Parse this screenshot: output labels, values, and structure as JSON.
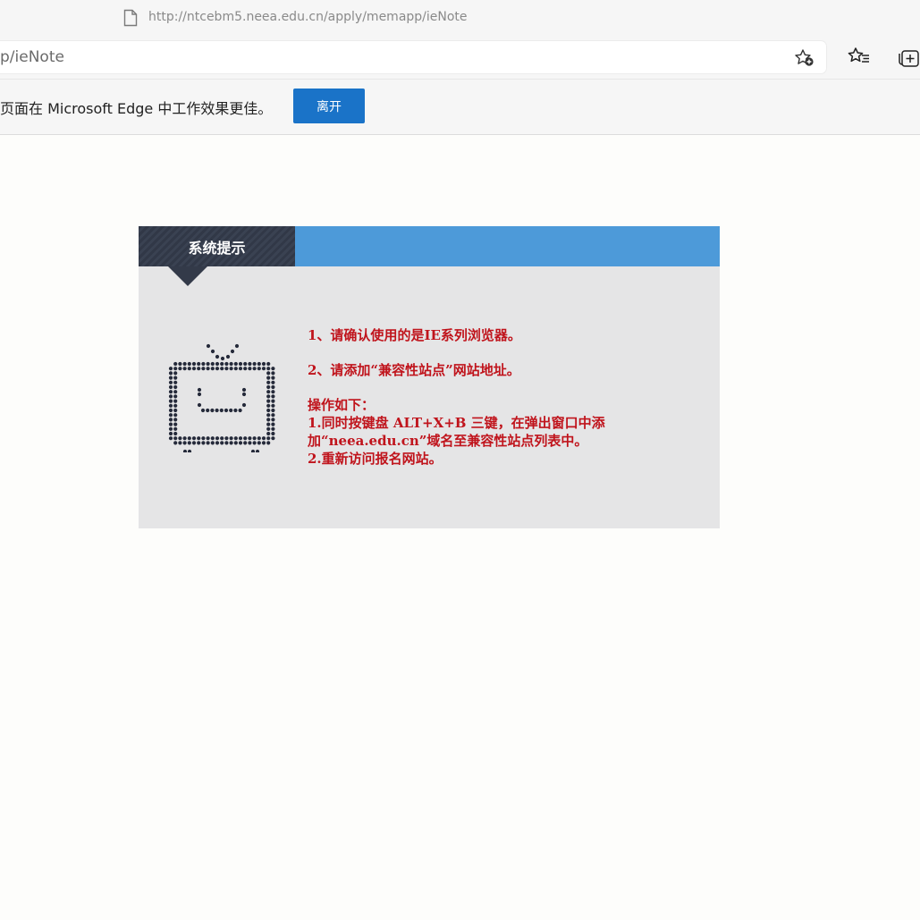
{
  "window": {
    "url": "http://ntcebm5.neea.edu.cn/apply/memapp/ieNote"
  },
  "addressbar": {
    "visible_text": "p/ieNote"
  },
  "toolbar": {
    "icons": [
      "add-favorite-icon",
      "favorites-icon",
      "collections-icon"
    ]
  },
  "infobar": {
    "message": "页面在 Microsoft Edge 中工作效果更佳。",
    "leave_label": "离开",
    "button_color": "#1a73c8"
  },
  "card": {
    "header_title": "系统提示",
    "header_color": "#4d9ad9",
    "tab_color": "#333a49",
    "text_color": "#c0141c",
    "item1": "1、请确认使用的是IE系列浏览器。",
    "item2": "2、请添加“兼容性站点”网站地址。",
    "steps_title": "操作如下：",
    "step1_line1": "1.同时按键盘 ALT+X+B 三键，在弹出窗口中添",
    "step1_line2": "加“neea.edu.cn”域名至兼容性站点列表中。",
    "step2": "2.重新访问报名网站。",
    "icon": "tv-icon"
  }
}
